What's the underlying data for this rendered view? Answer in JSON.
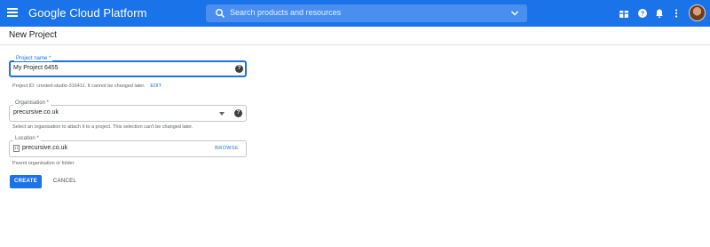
{
  "topbar": {
    "brand": "Google Cloud Platform",
    "search_placeholder": "Search products and resources",
    "icons": [
      "menu-icon",
      "search-icon",
      "chevron-down-icon",
      "gift-icon",
      "help-icon",
      "notifications-icon",
      "more-vert-icon",
      "avatar"
    ]
  },
  "page": {
    "title": "New Project"
  },
  "form": {
    "project_name": {
      "label": "Project name *",
      "value": "My Project 6455"
    },
    "project_id_hint": "Project ID: crested-studio-316411. It cannot be changed later.",
    "edit_label": "EDIT",
    "organisation": {
      "label": "Organisation *",
      "value": "precursive.co.uk",
      "hint": "Select an organisation to attach it to a project. This selection can't be changed later."
    },
    "location": {
      "label": "Location *",
      "value": "precursive.co.uk",
      "browse_label": "BROWSE",
      "hint": "Parent organisation or folder"
    }
  },
  "actions": {
    "create_label": "CREATE",
    "cancel_label": "CANCEL"
  },
  "colors": {
    "primary": "#1a73e8",
    "topbar": "#1a73e8"
  }
}
